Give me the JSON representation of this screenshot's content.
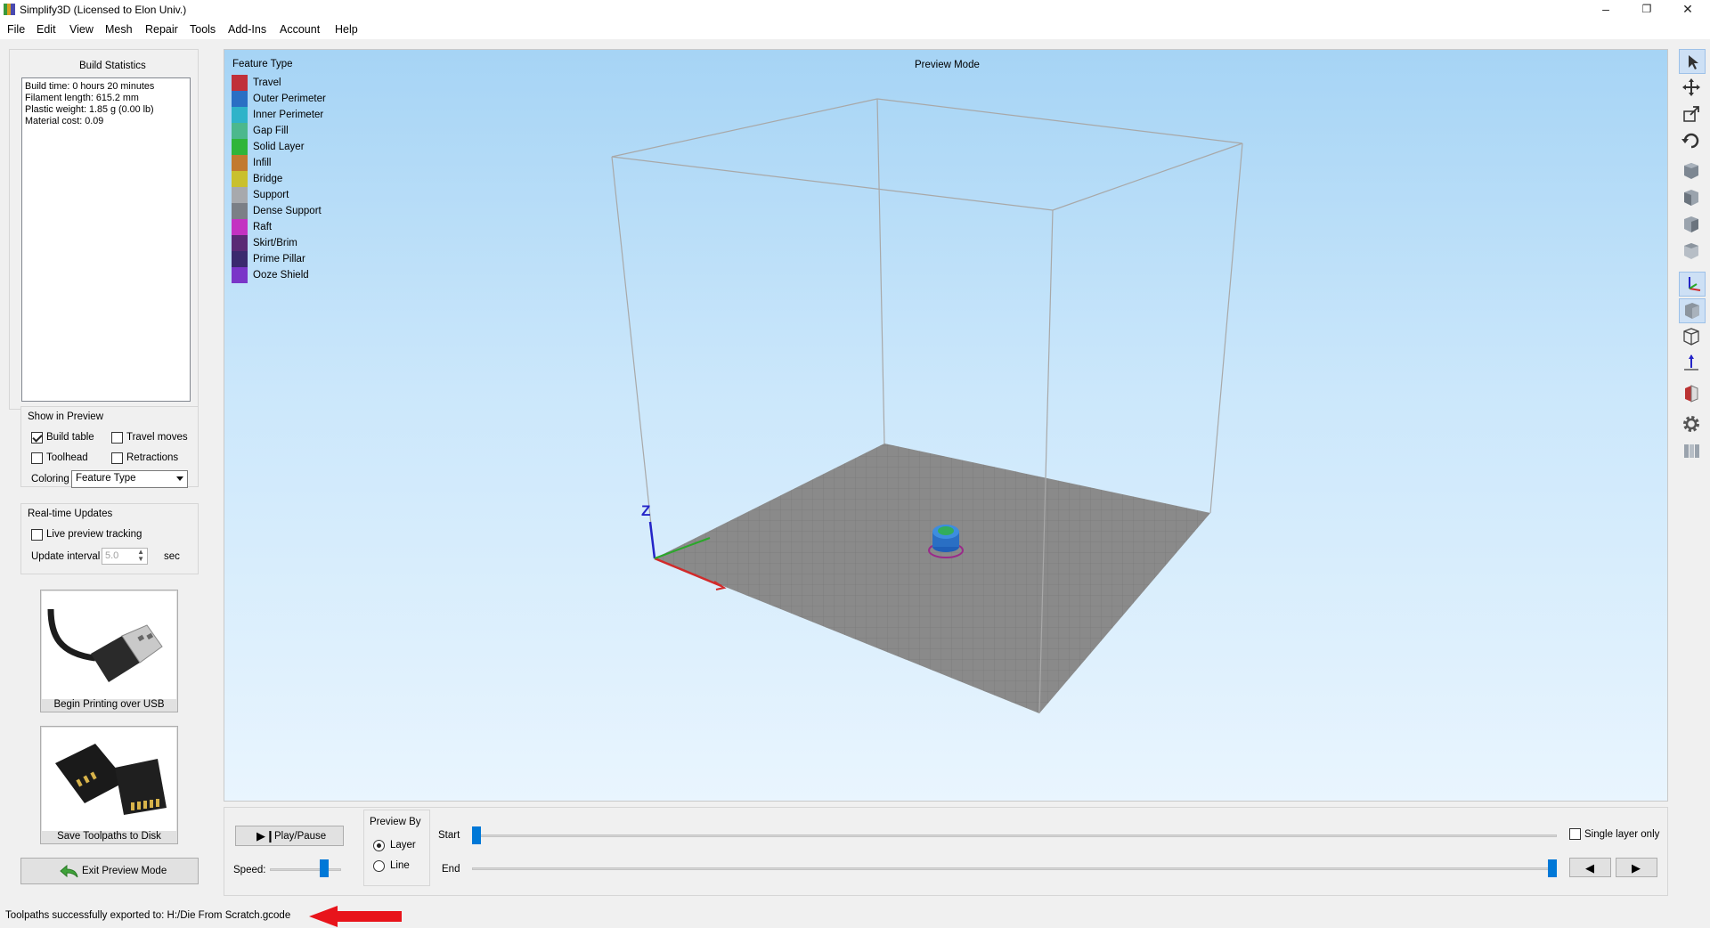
{
  "window": {
    "title": "Simplify3D (Licensed to Elon Univ.)",
    "controls": {
      "minimize": "–",
      "restore": "❐",
      "close": "✕"
    }
  },
  "menu": [
    "File",
    "Edit",
    "View",
    "Mesh",
    "Repair",
    "Tools",
    "Add-Ins",
    "Account",
    "Help"
  ],
  "build_stats": {
    "title": "Build Statistics",
    "lines": [
      "Build time: 0 hours 20 minutes",
      "Filament length: 615.2 mm",
      "Plastic weight: 1.85 g (0.00 lb)",
      "Material cost: 0.09"
    ]
  },
  "show_in_preview": {
    "title": "Show in Preview",
    "build_table": "Build table",
    "travel_moves": "Travel moves",
    "toolhead": "Toolhead",
    "retractions": "Retractions",
    "coloring_label": "Coloring",
    "coloring_value": "Feature Type",
    "build_table_checked": true,
    "travel_moves_checked": false,
    "toolhead_checked": false,
    "retractions_checked": false
  },
  "realtime": {
    "title": "Real-time Updates",
    "live_tracking": "Live preview tracking",
    "live_tracking_checked": false,
    "interval_label": "Update interval",
    "interval_value": "5.0",
    "interval_unit": "sec"
  },
  "actions": {
    "usb": "Begin Printing over USB",
    "disk": "Save Toolpaths to Disk",
    "exit": "Exit Preview Mode"
  },
  "viewport": {
    "mode_title": "Preview Mode",
    "legend_title": "Feature Type",
    "axis_label": "Z",
    "legend": [
      {
        "name": "Travel",
        "color": "#c0303a"
      },
      {
        "name": "Outer Perimeter",
        "color": "#2a6fc4"
      },
      {
        "name": "Inner Perimeter",
        "color": "#2fb3c9"
      },
      {
        "name": "Gap Fill",
        "color": "#4cb88d"
      },
      {
        "name": "Solid Layer",
        "color": "#2fb53a"
      },
      {
        "name": "Infill",
        "color": "#c27a30"
      },
      {
        "name": "Bridge",
        "color": "#c9c02e"
      },
      {
        "name": "Support",
        "color": "#a7a9ad"
      },
      {
        "name": "Dense Support",
        "color": "#7b7f86"
      },
      {
        "name": "Raft",
        "color": "#c332c2"
      },
      {
        "name": "Skirt/Brim",
        "color": "#5a2a75"
      },
      {
        "name": "Prime Pillar",
        "color": "#3a2a6e"
      },
      {
        "name": "Ooze Shield",
        "color": "#7a36c8"
      }
    ]
  },
  "toolbar_icons": [
    "select-arrow-icon",
    "move-icon",
    "scale-icon",
    "rotate-icon",
    "view-cube-icon",
    "view-front-icon",
    "view-side-icon",
    "view-back-icon",
    "axes-icon",
    "solid-view-icon",
    "wireframe-icon",
    "build-axis-icon",
    "cut-section-icon",
    "settings-gear-icon",
    "layer-toggle-icon"
  ],
  "playback": {
    "play_label": "Play/Pause",
    "speed_label": "Speed:",
    "preview_by_title": "Preview By",
    "layer_label": "Layer",
    "line_label": "Line",
    "start_label": "Start",
    "end_label": "End",
    "single_layer_label": "Single layer only",
    "speed_level": 0.8,
    "start_level": 0.0,
    "end_level": 1.0
  },
  "status": {
    "message": "Toolpaths successfully exported to: H:/Die From Scratch.gcode"
  }
}
